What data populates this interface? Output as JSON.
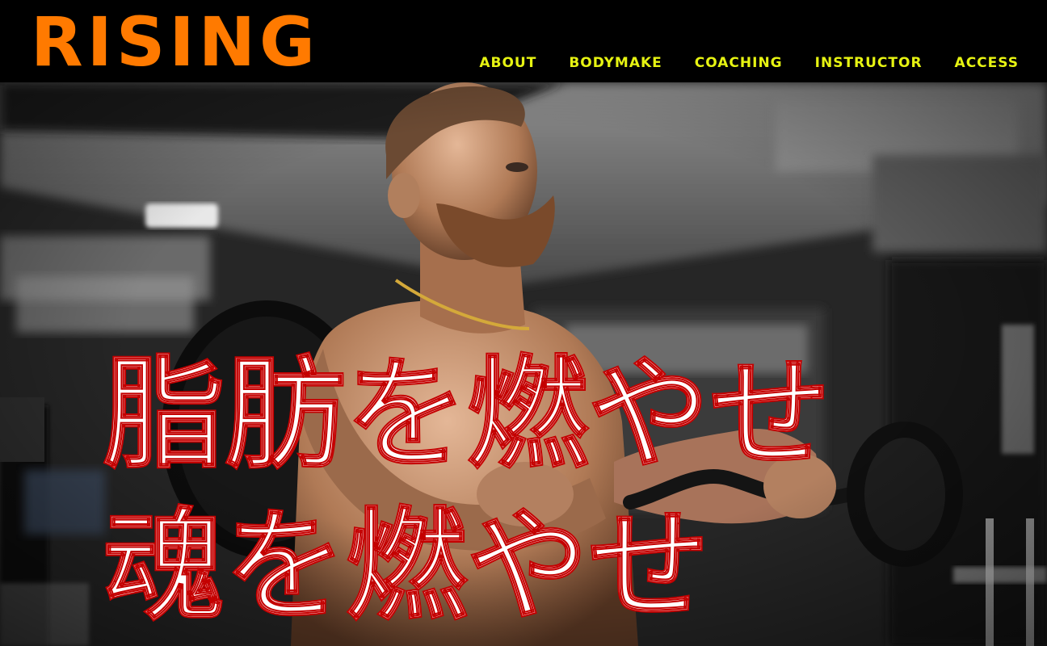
{
  "site": {
    "logo": "RISING"
  },
  "nav": {
    "items": [
      {
        "label": "ABOUT"
      },
      {
        "label": "BODYMAKE"
      },
      {
        "label": "COACHING"
      },
      {
        "label": "INSTRUCTOR"
      },
      {
        "label": "ACCESS"
      }
    ]
  },
  "hero": {
    "line1": "脂肪を燃やせ",
    "line2": "魂を燃やせ",
    "image_subject": "man-lifting-curl-bar-in-gym"
  },
  "colors": {
    "logo": "#ff7a00",
    "nav": "#e6f312",
    "headline_fill": "#ffffff",
    "headline_stroke": "#c40000",
    "header_bg": "#000000"
  }
}
